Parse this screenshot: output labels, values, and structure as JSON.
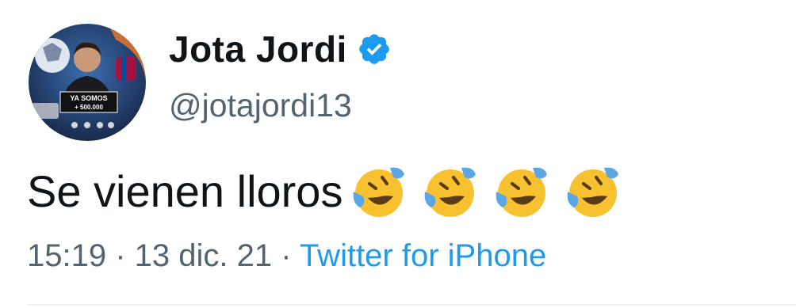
{
  "tweet": {
    "display_name": "Jota Jordi",
    "handle": "@jotajordi13",
    "text": "Se vienen lloros",
    "emoji": [
      "rolling-on-floor-laughing",
      "rolling-on-floor-laughing",
      "rolling-on-floor-laughing",
      "rolling-on-floor-laughing"
    ],
    "time": "15:19",
    "separator1": " · ",
    "date": "13 dic. 21",
    "separator2": " · ",
    "source": "Twitter for iPhone"
  },
  "avatar": {
    "banner_line1": "YA SOMOS",
    "banner_line2": "+ 500.000"
  },
  "colors": {
    "verified": "#1d9bf0",
    "link": "#1d9bf0",
    "secondary_text": "#536471",
    "primary_text": "#0f1419",
    "emoji_face": "#f8c12f",
    "emoji_tear": "#5ba7e6"
  }
}
